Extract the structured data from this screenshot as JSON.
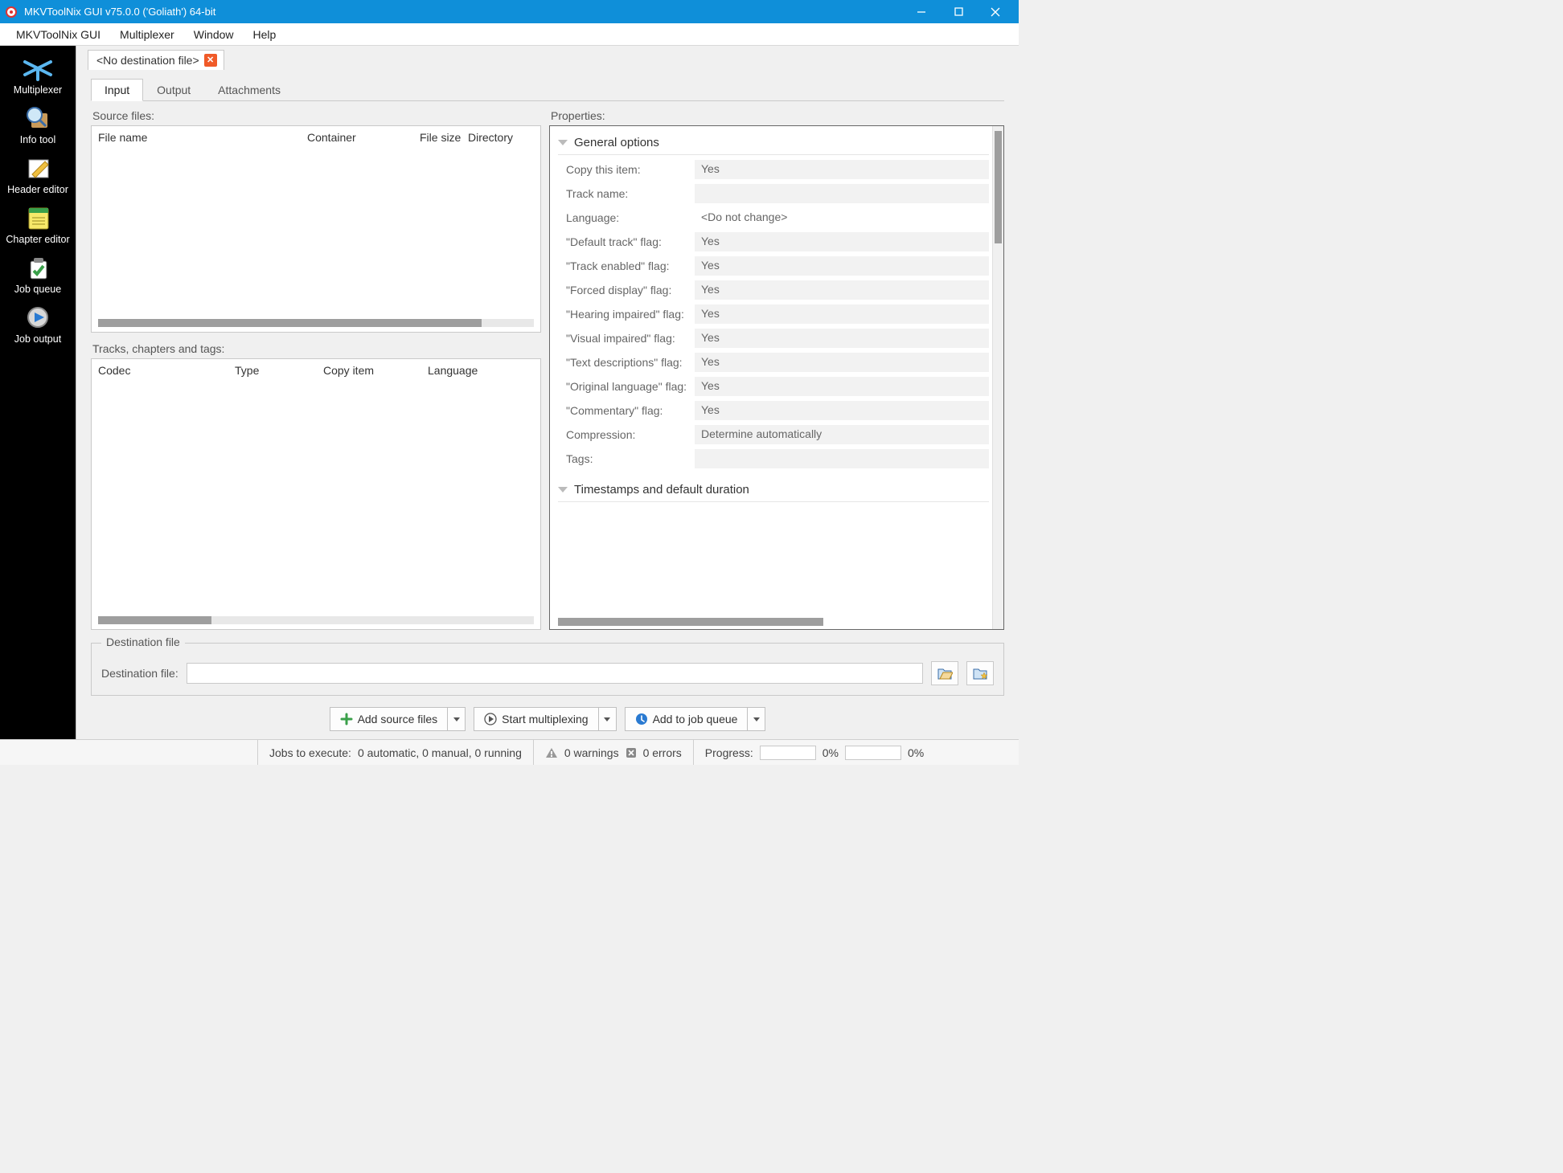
{
  "window": {
    "title": "MKVToolNix GUI v75.0.0 ('Goliath') 64-bit"
  },
  "menu": {
    "items": [
      "MKVToolNix GUI",
      "Multiplexer",
      "Window",
      "Help"
    ]
  },
  "sidebar": {
    "items": [
      {
        "label": "Multiplexer",
        "icon": "multiplexer"
      },
      {
        "label": "Info tool",
        "icon": "info"
      },
      {
        "label": "Header editor",
        "icon": "header"
      },
      {
        "label": "Chapter editor",
        "icon": "chapter"
      },
      {
        "label": "Job queue",
        "icon": "queue"
      },
      {
        "label": "Job output",
        "icon": "output"
      }
    ]
  },
  "doctab": {
    "label": "<No destination file>"
  },
  "mode_tabs": {
    "input": "Input",
    "output": "Output",
    "attachments": "Attachments"
  },
  "source": {
    "label": "Source files:",
    "columns": {
      "filename": "File name",
      "container": "Container",
      "filesize": "File size",
      "directory": "Directory"
    }
  },
  "tracks": {
    "label": "Tracks, chapters and tags:",
    "columns": {
      "codec": "Codec",
      "type": "Type",
      "copy": "Copy item",
      "language": "Language"
    }
  },
  "properties": {
    "label": "Properties:",
    "group_general": "General options",
    "group_timestamps": "Timestamps and default duration",
    "rows": {
      "copy_item": {
        "label": "Copy this item:",
        "value": "Yes"
      },
      "track_name": {
        "label": "Track name:",
        "value": ""
      },
      "language": {
        "label": "Language:",
        "value": "<Do not change>"
      },
      "default_track": {
        "label": "\"Default track\" flag:",
        "value": "Yes"
      },
      "track_enabled": {
        "label": "\"Track enabled\" flag:",
        "value": "Yes"
      },
      "forced_display": {
        "label": "\"Forced display\" flag:",
        "value": "Yes"
      },
      "hearing_impaired": {
        "label": "\"Hearing impaired\" flag:",
        "value": "Yes"
      },
      "visual_impaired": {
        "label": "\"Visual impaired\" flag:",
        "value": "Yes"
      },
      "text_descriptions": {
        "label": "\"Text descriptions\" flag:",
        "value": "Yes"
      },
      "original_language": {
        "label": "\"Original language\" flag:",
        "value": "Yes"
      },
      "commentary": {
        "label": "\"Commentary\" flag:",
        "value": "Yes"
      },
      "compression": {
        "label": "Compression:",
        "value": "Determine automatically"
      },
      "tags": {
        "label": "Tags:",
        "value": ""
      }
    }
  },
  "destination": {
    "legend": "Destination file",
    "label": "Destination file:",
    "value": ""
  },
  "actions": {
    "add_source": "Add source files",
    "start_mux": "Start multiplexing",
    "add_queue": "Add to job queue"
  },
  "status": {
    "jobs_label": "Jobs to execute:",
    "jobs_value": "0 automatic, 0 manual, 0 running",
    "warnings": "0 warnings",
    "errors": "0 errors",
    "progress_label": "Progress:",
    "percent_a": "0%",
    "percent_b": "0%"
  }
}
